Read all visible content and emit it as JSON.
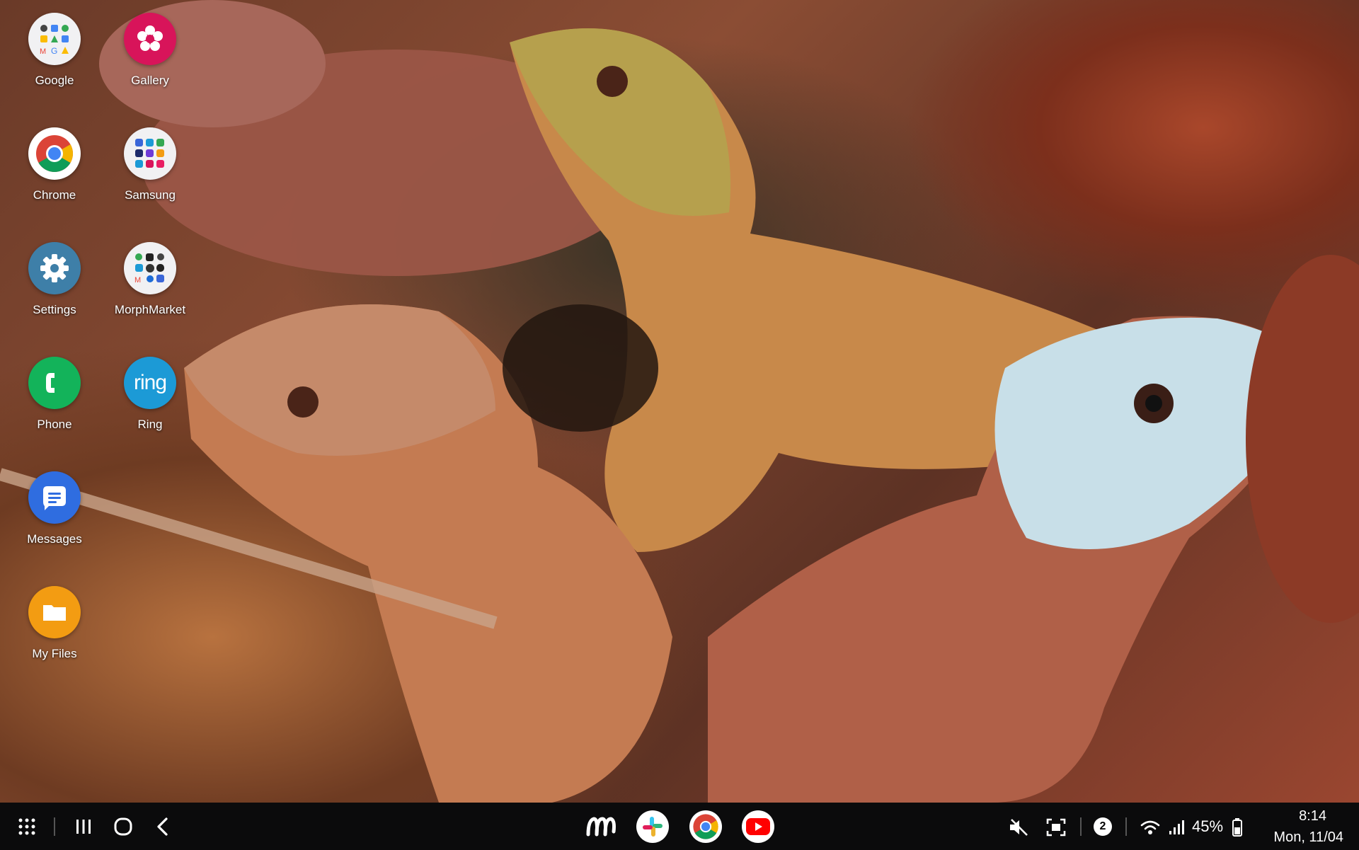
{
  "home_icons": [
    {
      "label": "Google",
      "icon": "google-folder-icon"
    },
    {
      "label": "Gallery",
      "icon": "gallery-icon"
    },
    {
      "label": "Chrome",
      "icon": "chrome-icon"
    },
    {
      "label": "Samsung",
      "icon": "samsung-folder-icon"
    },
    {
      "label": "Settings",
      "icon": "gear-icon"
    },
    {
      "label": "MorphMarket",
      "icon": "morphmarket-folder-icon"
    },
    {
      "label": "Phone",
      "icon": "phone-icon"
    },
    {
      "label": "Ring",
      "icon": "ring-icon",
      "glyph": "ring"
    },
    {
      "label": "Messages",
      "icon": "messages-icon"
    },
    {
      "label": "My Files",
      "icon": "folder-icon"
    }
  ],
  "taskbar": {
    "pinned": [
      "app-icon",
      "slack-icon",
      "chrome-icon",
      "youtube-icon"
    ],
    "notification_count": "2",
    "battery": "45%",
    "time": "8:14",
    "date": "Mon, 11/04"
  },
  "colors": {
    "gallery": "#d8145a",
    "phone": "#13b35a",
    "ring": "#1c9ad6",
    "messages": "#2f6de0",
    "myfiles": "#f39c12",
    "settings": "#3e7fa8",
    "taskbar": "#0b0b0c"
  }
}
